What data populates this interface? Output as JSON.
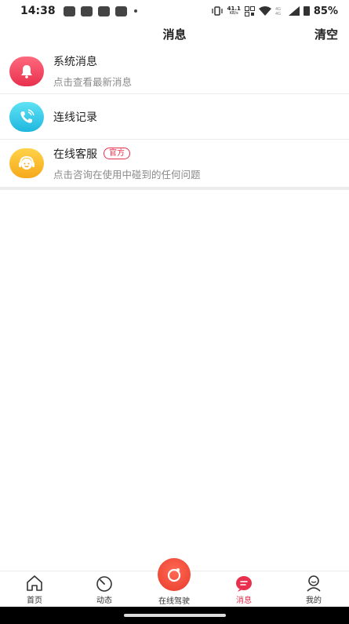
{
  "status_bar": {
    "time": "14:38",
    "network_speed_top": "41.1",
    "network_speed_bottom": "KB/s",
    "battery": "85%"
  },
  "header": {
    "title": "消息",
    "clear_label": "清空"
  },
  "messages": [
    {
      "title": "系统消息",
      "subtitle": "点击查看最新消息",
      "icon": "bell-icon",
      "color": "#e8304e"
    },
    {
      "title": "连线记录",
      "subtitle": "",
      "icon": "phone-icon",
      "color": "#1fb7df"
    },
    {
      "title": "在线客服",
      "subtitle": "点击咨询在使用中碰到的任何问题",
      "badge": "官方",
      "icon": "headset-icon",
      "color": "#f6a91a"
    }
  ],
  "bottom_nav": {
    "items": [
      {
        "label": "首页",
        "icon": "home-icon"
      },
      {
        "label": "动态",
        "icon": "speedometer-icon"
      },
      {
        "label": "在线驾驶",
        "icon": "drive-icon"
      },
      {
        "label": "消息",
        "icon": "message-icon",
        "active": true
      },
      {
        "label": "我的",
        "icon": "profile-icon"
      }
    ],
    "active_color": "#e8304e"
  }
}
